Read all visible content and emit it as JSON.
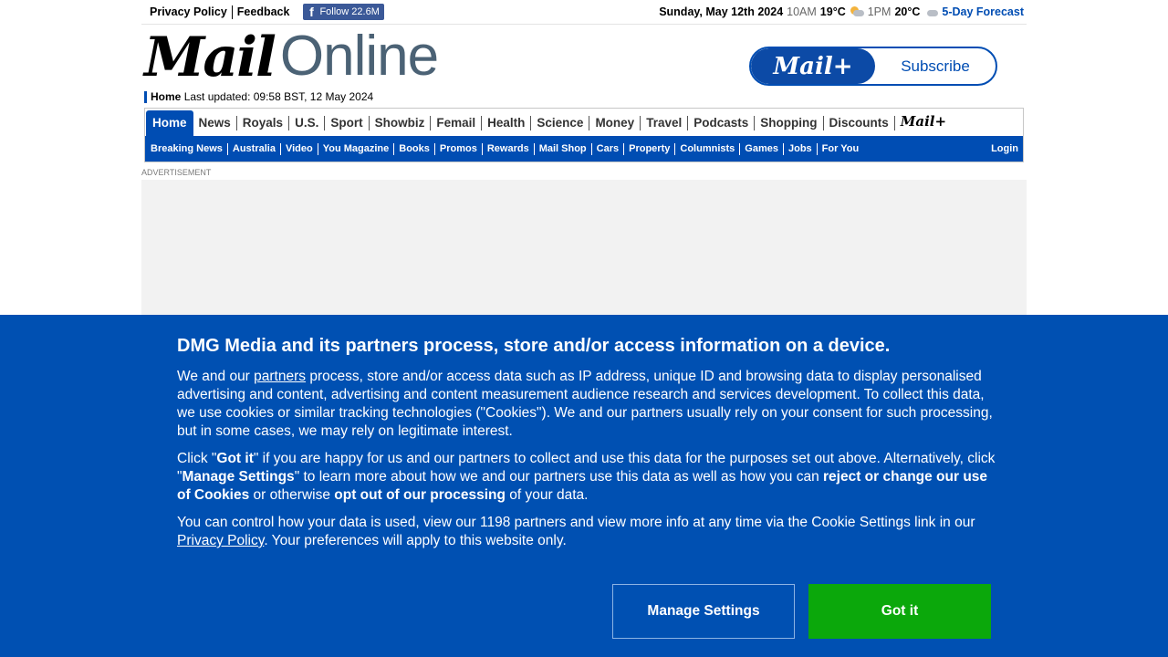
{
  "topbar": {
    "privacy_policy": "Privacy Policy",
    "feedback": "Feedback",
    "facebook_follow": "Follow 22.6M",
    "date": "Sunday, May 12th 2024",
    "time1": "10AM",
    "temp1": "19°C",
    "time2": "1PM",
    "temp2": "20°C",
    "forecast_link": "5-Day Forecast"
  },
  "masthead": {
    "logo_mail": "Mail",
    "logo_online": "Online",
    "home_label": "Home",
    "last_updated": "Last updated: 09:58 BST, 12 May 2024",
    "subscribe_brand": "Mail+",
    "subscribe_label": "Subscribe"
  },
  "nav": {
    "primary": [
      "Home",
      "News",
      "Royals",
      "U.S.",
      "Sport",
      "Showbiz",
      "Femail",
      "Health",
      "Science",
      "Money",
      "Travel",
      "Podcasts",
      "Shopping",
      "Discounts"
    ],
    "primary_brand": "Mail+",
    "secondary": [
      "Breaking News",
      "Australia",
      "Video",
      "You Magazine",
      "Books",
      "Promos",
      "Rewards",
      "Mail Shop",
      "Cars",
      "Property",
      "Columnists",
      "Games",
      "Jobs",
      "For You"
    ],
    "login": "Login"
  },
  "ad": {
    "label": "ADVERTISEMENT"
  },
  "consent": {
    "title": "DMG Media and its partners process, store and/or access information on a device.",
    "p1_a": "We and our ",
    "p1_link": "partners",
    "p1_b": " process, store and/or access data such as IP address, unique ID and browsing data to display personalised advertising and content, advertising and content measurement audience research and services development. To collect this data, we use cookies or similar tracking technologies (\"Cookies\"). We and our partners usually rely on your consent for such processing, but in some cases, we may rely on legitimate interest.",
    "p2_a": "Click \"",
    "p2_gotit": "Got it",
    "p2_b": "\" if you are happy for us and our partners to collect and use this data for the purposes set out above. Alternatively, click \"",
    "p2_manage": "Manage Settings",
    "p2_c": "\" to learn more about how we and our partners use this data as well as how you can ",
    "p2_reject": "reject or change our use of Cookies",
    "p2_d": " or otherwise ",
    "p2_optout": "opt out of our processing",
    "p2_e": " of your data.",
    "p3_a": "You can control how your data is used, view our 1198 partners and view more info at any time via the Cookie Settings link in our ",
    "p3_link": "Privacy Policy",
    "p3_b": ". Your preferences will apply to this website only.",
    "manage_button": "Manage Settings",
    "got_it_button": "Got it"
  },
  "colors": {
    "brand_blue": "#004db3",
    "consent_bg": "#0050b2",
    "got_it_green": "#0ba80b"
  }
}
